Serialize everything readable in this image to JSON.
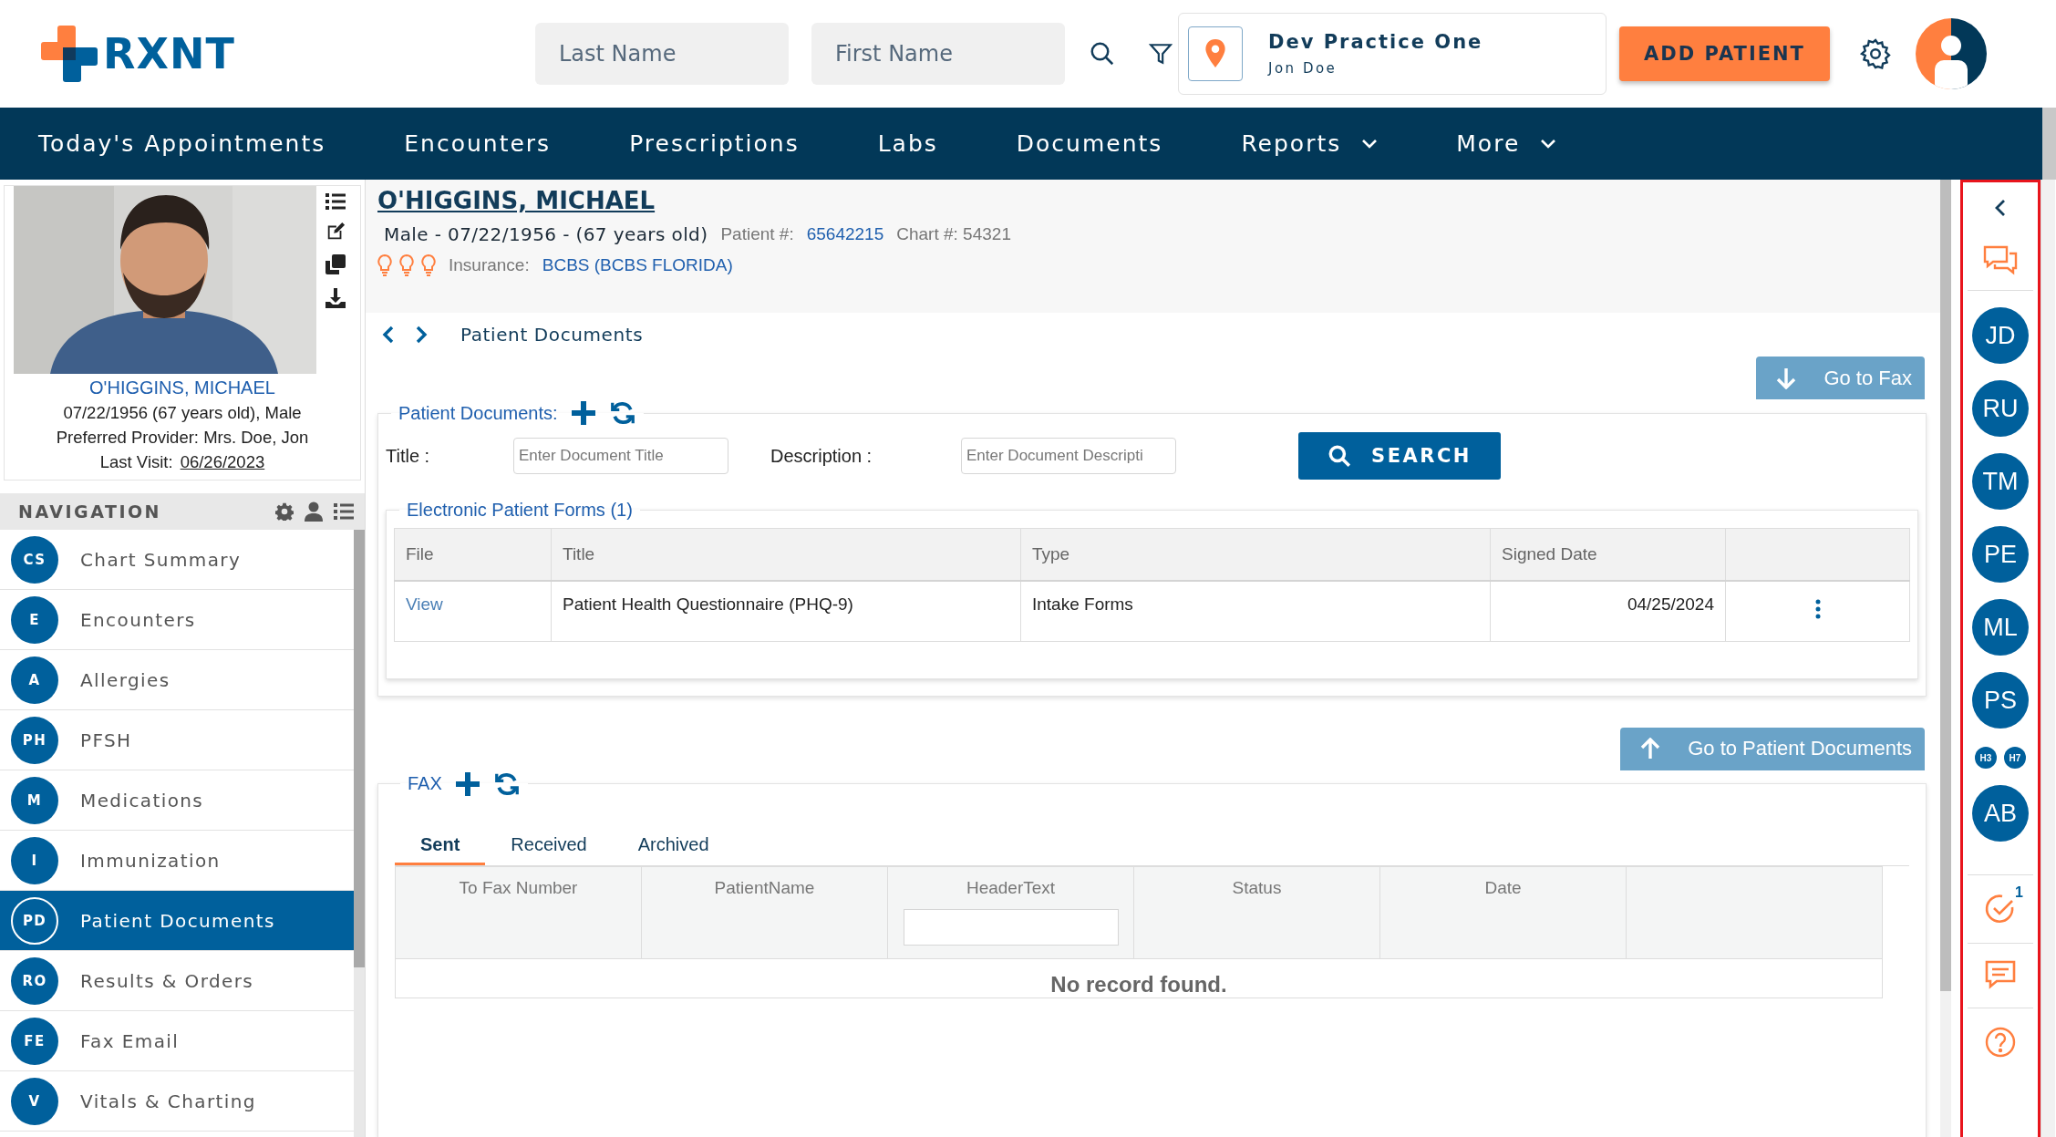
{
  "header": {
    "logo": "RXNT",
    "last_name": {
      "placeholder": "Last Name"
    },
    "first_name": {
      "placeholder": "First Name"
    },
    "practice": {
      "name": "Dev Practice One",
      "user": "Jon Doe"
    },
    "add_button": "ADD PATIENT"
  },
  "menu": [
    {
      "label": "Today's Appointments",
      "dropdown": false
    },
    {
      "label": "Encounters",
      "dropdown": false
    },
    {
      "label": "Prescriptions",
      "dropdown": false
    },
    {
      "label": "Labs",
      "dropdown": false
    },
    {
      "label": "Documents",
      "dropdown": false
    },
    {
      "label": "Reports",
      "dropdown": true
    },
    {
      "label": "More",
      "dropdown": true
    }
  ],
  "patient_card": {
    "name": "O'HIGGINS, MICHAEL",
    "details": "07/22/1956 (67 years old), Male",
    "provider": "Preferred Provider: Mrs. Doe, Jon",
    "last_visit_label": "Last Visit:",
    "last_visit": "06/26/2023"
  },
  "navigation": {
    "title": "NAVIGATION",
    "items": [
      {
        "abbr": "CS",
        "label": "Chart Summary",
        "selected": false
      },
      {
        "abbr": "E",
        "label": "Encounters",
        "selected": false
      },
      {
        "abbr": "A",
        "label": "Allergies",
        "selected": false
      },
      {
        "abbr": "PH",
        "label": "PFSH",
        "selected": false
      },
      {
        "abbr": "M",
        "label": "Medications",
        "selected": false
      },
      {
        "abbr": "I",
        "label": "Immunization",
        "selected": false
      },
      {
        "abbr": "PD",
        "label": "Patient Documents",
        "selected": true
      },
      {
        "abbr": "RO",
        "label": "Results & Orders",
        "selected": false
      },
      {
        "abbr": "FE",
        "label": "Fax Email",
        "selected": false
      },
      {
        "abbr": "V",
        "label": "Vitals & Charting",
        "selected": false
      }
    ]
  },
  "patient_header": {
    "name": "O'HIGGINS, MICHAEL",
    "demographics": "Male - 07/22/1956 - (67 years old)",
    "patient_no_label": "Patient #:",
    "patient_no": "65642215",
    "chart_no": "Chart #: 54321",
    "insurance_label": "Insurance:",
    "insurance": "BCBS (BCBS FLORIDA)"
  },
  "breadcrumb": "Patient Documents",
  "documents": {
    "go_button": "Go to Fax",
    "title": "Patient Documents:",
    "title_label": "Title :",
    "title_field": {
      "placeholder": "Enter Document Title"
    },
    "description_label": "Description :",
    "description_field": {
      "placeholder": "Enter Document Descripti"
    },
    "search_button": "SEARCH",
    "forms": {
      "title": "Electronic Patient Forms (1)",
      "columns": [
        "File",
        "Title",
        "Type",
        "Signed Date"
      ],
      "rows": [
        {
          "file": "View",
          "title": "Patient Health Questionnaire (PHQ-9)",
          "type": "Intake Forms",
          "signed_date": "04/25/2024"
        }
      ]
    }
  },
  "fax": {
    "go_button": "Go to Patient Documents",
    "title": "FAX",
    "tabs": [
      {
        "label": "Sent",
        "selected": true
      },
      {
        "label": "Received",
        "selected": false
      },
      {
        "label": "Archived",
        "selected": false
      }
    ],
    "columns": [
      "To Fax Number",
      "PatientName",
      "HeaderText",
      "Status",
      "Date"
    ],
    "empty": "No record found."
  },
  "rail": {
    "users": [
      {
        "initials": "JD"
      },
      {
        "initials": "RU"
      },
      {
        "initials": "TM"
      },
      {
        "initials": "PE"
      },
      {
        "initials": "ML"
      },
      {
        "initials": "PS"
      }
    ],
    "small_users": [
      {
        "initials": "H3"
      },
      {
        "initials": "H7"
      }
    ],
    "last_user": "AB",
    "task_count": "1"
  }
}
